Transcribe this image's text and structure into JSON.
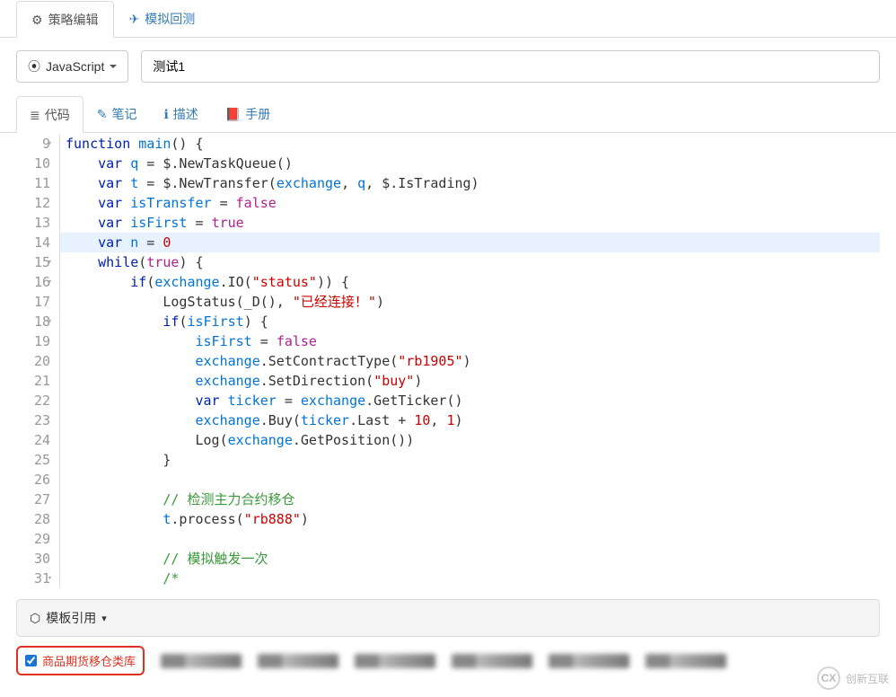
{
  "mainTabs": {
    "edit": "策略编辑",
    "backtest": "模拟回测"
  },
  "language": {
    "label": "JavaScript"
  },
  "strategyName": "测试1",
  "subTabs": {
    "code": "代码",
    "notes": "笔记",
    "desc": "描述",
    "manual": "手册"
  },
  "code": {
    "startLine": 9,
    "highlightIndex": 5,
    "foldLines": [
      0,
      6,
      7,
      9,
      22
    ],
    "lines": [
      [
        [
          "k-kw",
          "function"
        ],
        [
          "k-pun",
          " "
        ],
        [
          "k-fn",
          "main"
        ],
        [
          "k-pun",
          "() {"
        ]
      ],
      [
        [
          "k-pun",
          "    "
        ],
        [
          "k-kw",
          "var"
        ],
        [
          "k-pun",
          " "
        ],
        [
          "k-var",
          "q"
        ],
        [
          "k-pun",
          " = $.NewTaskQueue()"
        ]
      ],
      [
        [
          "k-pun",
          "    "
        ],
        [
          "k-kw",
          "var"
        ],
        [
          "k-pun",
          " "
        ],
        [
          "k-var",
          "t"
        ],
        [
          "k-pun",
          " = $.NewTransfer("
        ],
        [
          "k-var",
          "exchange"
        ],
        [
          "k-pun",
          ", "
        ],
        [
          "k-var",
          "q"
        ],
        [
          "k-pun",
          ", $.IsTrading)"
        ]
      ],
      [
        [
          "k-pun",
          "    "
        ],
        [
          "k-kw",
          "var"
        ],
        [
          "k-pun",
          " "
        ],
        [
          "k-var",
          "isTransfer"
        ],
        [
          "k-pun",
          " = "
        ],
        [
          "k-bool",
          "false"
        ]
      ],
      [
        [
          "k-pun",
          "    "
        ],
        [
          "k-kw",
          "var"
        ],
        [
          "k-pun",
          " "
        ],
        [
          "k-var",
          "isFirst"
        ],
        [
          "k-pun",
          " = "
        ],
        [
          "k-bool",
          "true"
        ]
      ],
      [
        [
          "k-pun",
          "    "
        ],
        [
          "k-kw",
          "var"
        ],
        [
          "k-pun",
          " "
        ],
        [
          "k-var",
          "n"
        ],
        [
          "k-pun",
          " = "
        ],
        [
          "k-num",
          "0"
        ]
      ],
      [
        [
          "k-pun",
          "    "
        ],
        [
          "k-kw",
          "while"
        ],
        [
          "k-pun",
          "("
        ],
        [
          "k-bool",
          "true"
        ],
        [
          "k-pun",
          ") {"
        ]
      ],
      [
        [
          "k-pun",
          "        "
        ],
        [
          "k-kw",
          "if"
        ],
        [
          "k-pun",
          "("
        ],
        [
          "k-var",
          "exchange"
        ],
        [
          "k-pun",
          ".IO("
        ],
        [
          "k-str",
          "\"status\""
        ],
        [
          "k-pun",
          ")) {"
        ]
      ],
      [
        [
          "k-pun",
          "            LogStatus(_D(), "
        ],
        [
          "k-str",
          "\"已经连接！\""
        ],
        [
          "k-pun",
          ")"
        ]
      ],
      [
        [
          "k-pun",
          "            "
        ],
        [
          "k-kw",
          "if"
        ],
        [
          "k-pun",
          "("
        ],
        [
          "k-var",
          "isFirst"
        ],
        [
          "k-pun",
          ") {"
        ]
      ],
      [
        [
          "k-pun",
          "                "
        ],
        [
          "k-var",
          "isFirst"
        ],
        [
          "k-pun",
          " = "
        ],
        [
          "k-bool",
          "false"
        ]
      ],
      [
        [
          "k-pun",
          "                "
        ],
        [
          "k-var",
          "exchange"
        ],
        [
          "k-pun",
          ".SetContractType("
        ],
        [
          "k-str",
          "\"rb1905\""
        ],
        [
          "k-pun",
          ")"
        ]
      ],
      [
        [
          "k-pun",
          "                "
        ],
        [
          "k-var",
          "exchange"
        ],
        [
          "k-pun",
          ".SetDirection("
        ],
        [
          "k-str",
          "\"buy\""
        ],
        [
          "k-pun",
          ")"
        ]
      ],
      [
        [
          "k-pun",
          "                "
        ],
        [
          "k-kw",
          "var"
        ],
        [
          "k-pun",
          " "
        ],
        [
          "k-var",
          "ticker"
        ],
        [
          "k-pun",
          " = "
        ],
        [
          "k-var",
          "exchange"
        ],
        [
          "k-pun",
          ".GetTicker()"
        ]
      ],
      [
        [
          "k-pun",
          "                "
        ],
        [
          "k-var",
          "exchange"
        ],
        [
          "k-pun",
          ".Buy("
        ],
        [
          "k-var",
          "ticker"
        ],
        [
          "k-pun",
          ".Last + "
        ],
        [
          "k-num",
          "10"
        ],
        [
          "k-pun",
          ", "
        ],
        [
          "k-num",
          "1"
        ],
        [
          "k-pun",
          ")"
        ]
      ],
      [
        [
          "k-pun",
          "                Log("
        ],
        [
          "k-var",
          "exchange"
        ],
        [
          "k-pun",
          ".GetPosition())"
        ]
      ],
      [
        [
          "k-pun",
          "            }"
        ]
      ],
      [
        [
          "k-pun",
          ""
        ]
      ],
      [
        [
          "k-pun",
          "            "
        ],
        [
          "k-com",
          "// 检测主力合约移仓"
        ]
      ],
      [
        [
          "k-pun",
          "            "
        ],
        [
          "k-var",
          "t"
        ],
        [
          "k-pun",
          ".process("
        ],
        [
          "k-str",
          "\"rb888\""
        ],
        [
          "k-pun",
          ")"
        ]
      ],
      [
        [
          "k-pun",
          ""
        ]
      ],
      [
        [
          "k-pun",
          "            "
        ],
        [
          "k-com",
          "// 模拟触发一次"
        ]
      ],
      [
        [
          "k-pun",
          "            "
        ],
        [
          "k-com",
          "/*"
        ]
      ]
    ]
  },
  "templateRef": {
    "label": "模板引用"
  },
  "templateChecked": {
    "label": "商品期货移仓类库"
  },
  "watermark": {
    "brand": "创新互联",
    "logoText": "CX"
  }
}
